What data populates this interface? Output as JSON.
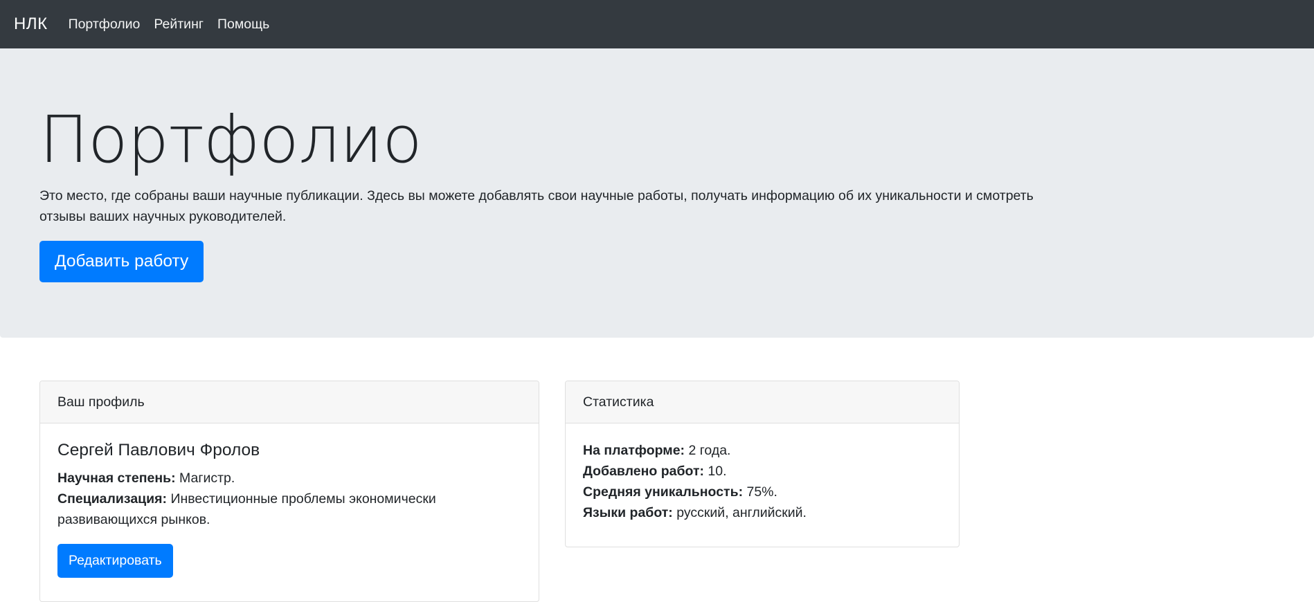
{
  "navbar": {
    "brand": "НЛК",
    "links": [
      "Портфолио",
      "Рейтинг",
      "Помощь"
    ]
  },
  "jumbotron": {
    "title": "Портфолио",
    "lead": "Это место, где собраны ваши научные публикации. Здесь вы можете добавлять свои научные работы, получать информацию об их уникальности и смотреть отзывы ваших научных руководителей.",
    "add_button": "Добавить работу"
  },
  "profile": {
    "header": "Ваш профиль",
    "name": "Сергей Павлович Фролов",
    "degree_label": "Научная степень:",
    "degree_value": " Магистр.",
    "spec_label": "Специализация:",
    "spec_value": " Инвестиционные проблемы экономически развивающихся рынков.",
    "edit_button": "Редактировать"
  },
  "stats": {
    "header": "Статистика",
    "items": [
      {
        "label": "На платформе:",
        "value": " 2 года."
      },
      {
        "label": "Добавлено работ:",
        "value": " 10."
      },
      {
        "label": "Средняя уникальность:",
        "value": " 75%."
      },
      {
        "label": "Языки работ:",
        "value": " русский, английский."
      }
    ]
  },
  "colors": {
    "navbar_bg": "#343a40",
    "jumbotron_bg": "#e9ecef",
    "primary": "#007bff"
  }
}
